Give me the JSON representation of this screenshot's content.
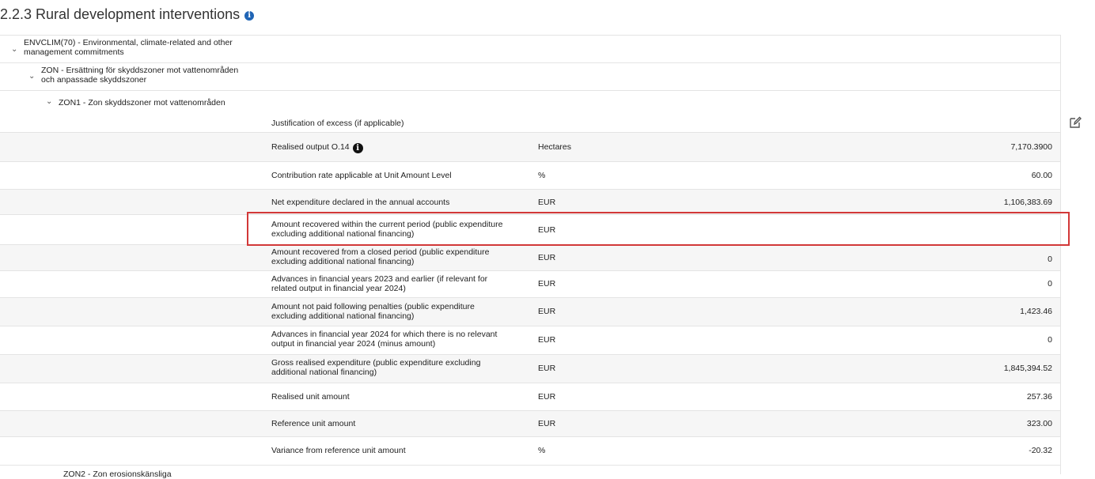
{
  "section": {
    "title": "2.2.3 Rural development interventions"
  },
  "tree": {
    "level1_label": "ENVCLIM(70) - Environmental, climate-related and other management commitments",
    "level1_line1": "ENVCLIM(70) - Environmental, climate-related and other",
    "level1_line2": "management commitments",
    "level2_line1": "ZON - Ersättning för skyddszoner mot vattenområden",
    "level2_line2": "och anpassade skyddszoner",
    "level3_label": "ZON1 - Zon skyddszoner mot vattenområden"
  },
  "rows": [
    {
      "label_line1": "Justification of excess (if applicable)",
      "label_line2": "",
      "unit": "",
      "value": ""
    },
    {
      "label_line1": "Realised output O.14",
      "label_line2": "",
      "unit": "Hectares",
      "value": "7,170.3900"
    },
    {
      "label_line1": "Contribution rate applicable at Unit Amount Level",
      "label_line2": "",
      "unit": "%",
      "value": "60.00"
    },
    {
      "label_line1": "Net expenditure declared in the annual accounts",
      "label_line2": "",
      "unit": "EUR",
      "value": "1,106,383.69"
    },
    {
      "label_line1": "Amount recovered within the current period (public expenditure",
      "label_line2": "excluding additional national financing)",
      "unit": "EUR",
      "value": ""
    },
    {
      "label_line1": "Amount recovered from a closed period (public expenditure",
      "label_line2": "excluding additional national financing)",
      "unit": "EUR",
      "value": "0"
    },
    {
      "label_line1": "Advances in financial years 2023 and earlier (if relevant for",
      "label_line2": "related output in financial year 2024)",
      "unit": "EUR",
      "value": "0"
    },
    {
      "label_line1": "Amount not paid following penalties (public expenditure",
      "label_line2": "excluding additional national financing)",
      "unit": "EUR",
      "value": "1,423.46"
    },
    {
      "label_line1": "Advances in financial year 2024 for which there is no relevant",
      "label_line2": "output in financial year 2024 (minus amount)",
      "unit": "EUR",
      "value": "0"
    },
    {
      "label_line1": "Gross realised expenditure (public expenditure excluding",
      "label_line2": "additional national financing)",
      "unit": "EUR",
      "value": "1,845,394.52"
    },
    {
      "label_line1": "Realised unit amount",
      "label_line2": "",
      "unit": "EUR",
      "value": "257.36"
    },
    {
      "label_line1": "Reference unit amount",
      "label_line2": "",
      "unit": "EUR",
      "value": "323.00"
    },
    {
      "label_line1": "Variance from reference unit amount",
      "label_line2": "",
      "unit": "%",
      "value": "-20.32"
    }
  ],
  "footer_partial": "ZON2 - Zon erosionskänsliga",
  "colors": {
    "highlight": "#d23838",
    "info_icon": "#1f64b5",
    "row_alt": "#f6f6f6"
  },
  "icons": [
    "info-icon",
    "chevron-down-icon",
    "edit-icon",
    "info-circle-black-icon"
  ]
}
